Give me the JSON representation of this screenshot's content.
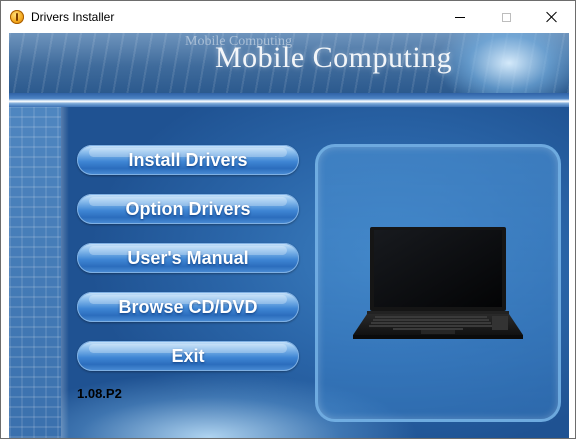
{
  "window": {
    "title": "Drivers Installer",
    "controls": {
      "minimize": "minimize",
      "maximize": "maximize",
      "close": "close"
    }
  },
  "banner": {
    "ghost_text": "Mobile Computing",
    "title": "Mobile Computing"
  },
  "menu": {
    "install_drivers": "Install Drivers",
    "option_drivers": "Option Drivers",
    "users_manual": "User's Manual",
    "browse_cd_dvd": "Browse CD/DVD",
    "exit": "Exit"
  },
  "version": "1.08.P2",
  "icons": {
    "app": "app-icon",
    "product": "laptop-image"
  },
  "colors": {
    "panel_blue": "#2a65a8",
    "button_blue": "#3f86d4",
    "button_text": "#ffffff"
  }
}
